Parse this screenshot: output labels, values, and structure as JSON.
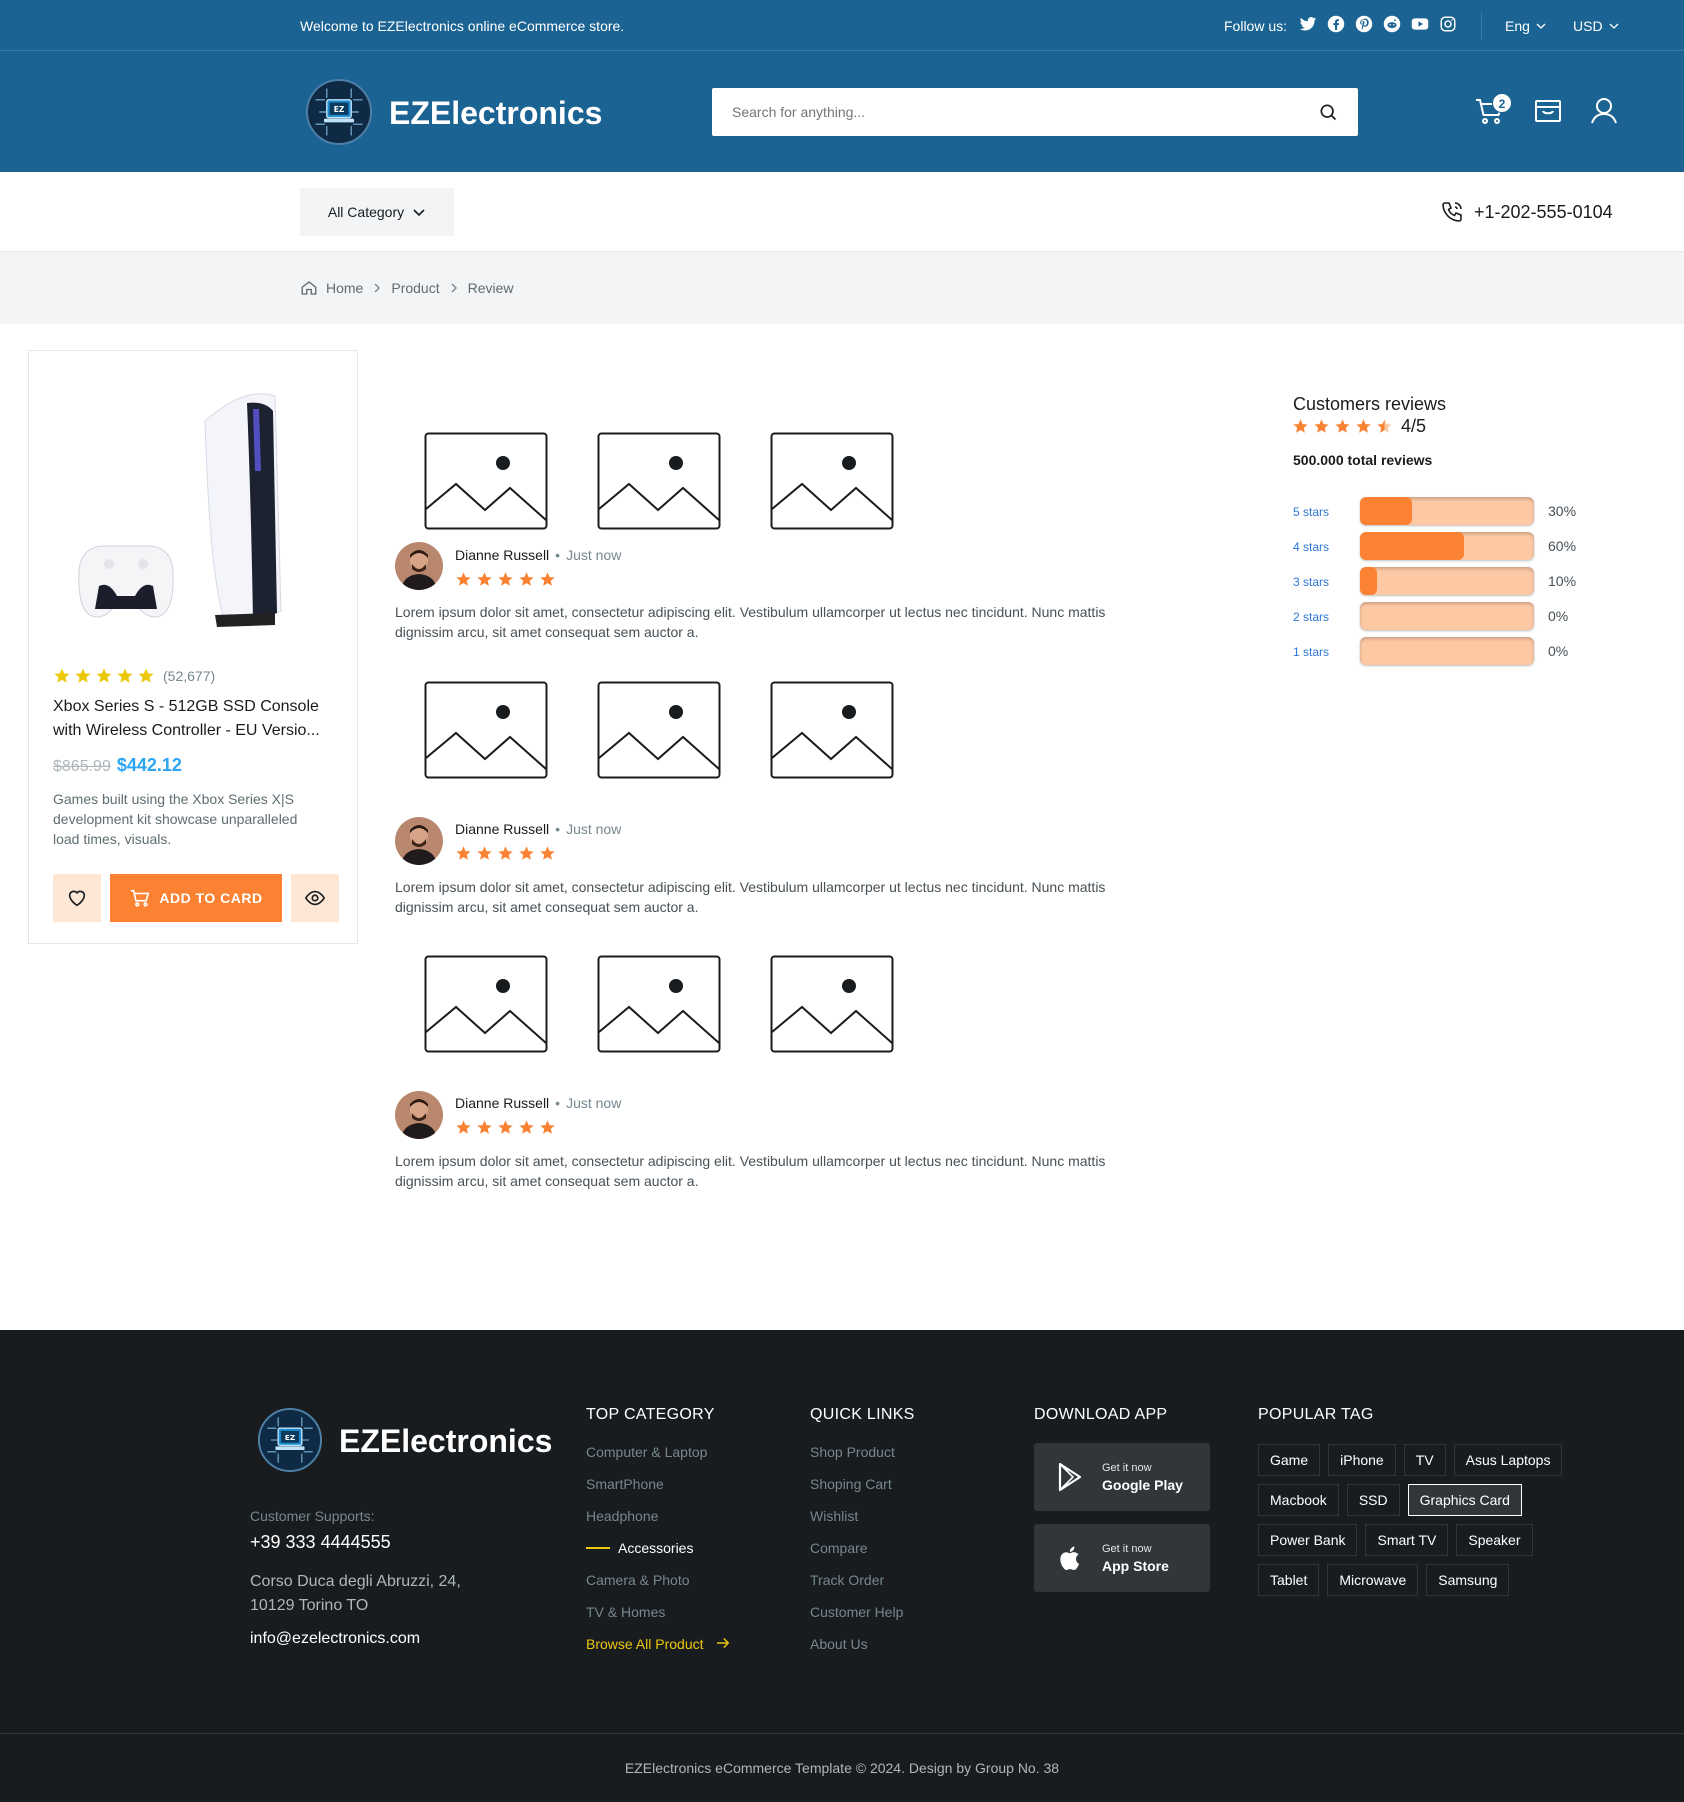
{
  "topbar": {
    "welcome": "Welcome to EZElectronics online eCommerce store.",
    "follow_label": "Follow us:",
    "social_icons": [
      "twitter-icon",
      "facebook-icon",
      "pinterest-icon",
      "reddit-icon",
      "youtube-icon",
      "instagram-icon"
    ],
    "language": "Eng",
    "currency": "USD"
  },
  "header": {
    "brand": "EZElectronics",
    "search_placeholder": "Search for anything...",
    "cart_count": "2"
  },
  "nav": {
    "all_category": "All Category",
    "phone": "+1-202-555-0104"
  },
  "breadcrumb": [
    "Home",
    "Product",
    "Review"
  ],
  "product": {
    "rating": 5,
    "review_count": "(52,677)",
    "title": "Xbox Series S - 512GB SSD Console with Wireless Controller - EU Versio...",
    "old_price": "$865.99",
    "new_price": "$442.12",
    "description": "Games built using the Xbox Series X|S development kit showcase unparalleled load times, visuals.",
    "add_to_cart": "ADD TO CARD"
  },
  "reviews": [
    {
      "name": "Dianne Russell",
      "time": "Just now",
      "stars": 5,
      "text": "Lorem ipsum dolor sit amet, consectetur adipiscing elit. Vestibulum ullamcorper ut lectus nec tincidunt. Nunc mattis dignissim arcu, sit amet consequat sem auctor a."
    },
    {
      "name": "Dianne Russell",
      "time": "Just now",
      "stars": 5,
      "text": "Lorem ipsum dolor sit amet, consectetur adipiscing elit. Vestibulum ullamcorper ut lectus nec tincidunt. Nunc mattis dignissim arcu, sit amet consequat sem auctor a."
    },
    {
      "name": "Dianne Russell",
      "time": "Just now",
      "stars": 5,
      "text": "Lorem ipsum dolor sit amet, consectetur adipiscing elit. Vestibulum ullamcorper ut lectus nec tincidunt. Nunc mattis dignissim arcu, sit amet consequat sem auctor a."
    }
  ],
  "summary": {
    "title": "Customers reviews",
    "rating": "4/5",
    "stars": 4.5,
    "total": "500.000 total reviews",
    "rows": [
      {
        "label": "5 stars",
        "pct": "30%",
        "value": 0.3
      },
      {
        "label": "4 stars",
        "pct": "60%",
        "value": 0.6
      },
      {
        "label": "3 stars",
        "pct": "10%",
        "value": 0.1
      },
      {
        "label": "2 stars",
        "pct": "0%",
        "value": 0
      },
      {
        "label": "1 stars",
        "pct": "0%",
        "value": 0
      }
    ]
  },
  "footer": {
    "brand": "EZElectronics",
    "support_label": "Customer Supports:",
    "phone": "+39 333 4444555",
    "address": "Corso Duca degli Abruzzi, 24, 10129 Torino TO",
    "email": "info@ezelectronics.com",
    "top_category": {
      "title": "TOP CATEGORY",
      "items": [
        "Computer & Laptop",
        "SmartPhone",
        "Headphone",
        "Accessories",
        "Camera & Photo",
        "TV & Homes"
      ],
      "active": "Accessories",
      "browse": "Browse All Product"
    },
    "quick_links": {
      "title": "QUICK LINKS",
      "items": [
        "Shop Product",
        "Shoping Cart",
        "Wishlist",
        "Compare",
        "Track Order",
        "Customer Help",
        "About Us"
      ]
    },
    "download": {
      "title": "DOWNLOAD APP",
      "apps": [
        {
          "small": "Get it now",
          "big": "Google Play",
          "icon": "google-play-icon"
        },
        {
          "small": "Get it now",
          "big": "App Store",
          "icon": "apple-icon"
        }
      ]
    },
    "tags": {
      "title": "POPULAR TAG",
      "items": [
        "Game",
        "iPhone",
        "TV",
        "Asus Laptops",
        "Macbook",
        "SSD",
        "Graphics Card",
        "Power Bank",
        "Smart TV",
        "Speaker",
        "Tablet",
        "Microwave",
        "Samsung"
      ],
      "selected": "Graphics Card"
    },
    "copyright": "EZElectronics eCommerce Template © 2024. Design by Group No. 38"
  },
  "colors": {
    "primary": "#1b6392",
    "accent": "#fa8232",
    "accent_light": "#ffe7d6",
    "star": "#ebc80c",
    "review_star": "#fa8232",
    "price": "#2da5f3",
    "footer_bg": "#191c1f"
  }
}
